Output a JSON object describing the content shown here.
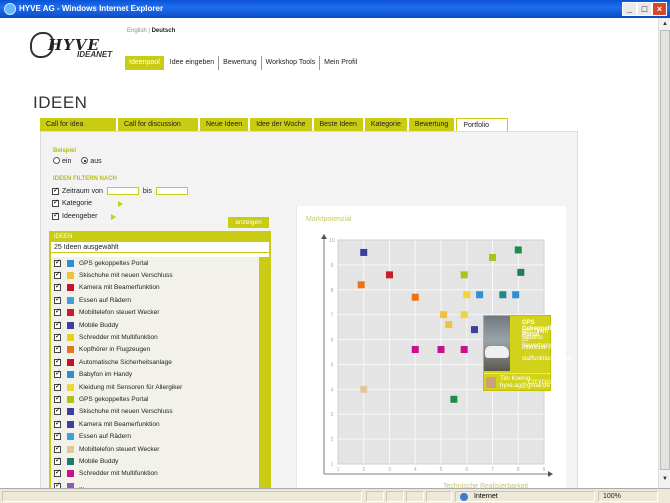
{
  "window": {
    "title": "HYVE AG - Windows Internet Explorer"
  },
  "header": {
    "logo_text": "HYVE",
    "logo_sub": "IDEANET",
    "lang_english": "English",
    "lang_sep": " | ",
    "lang_deutsch": "Deutsch",
    "nav": [
      "Ideenpool",
      "Idee eingeben",
      "Bewertung",
      "Workshop Tools",
      "Mein Profil"
    ]
  },
  "page": {
    "title": "IDEEN",
    "tabs": [
      "Call for idea",
      "Call for discussion",
      "Neue Ideen",
      "Idee der Woche",
      "Beste Ideen",
      "Kategorie",
      "Bewertung",
      "Portfolio"
    ],
    "active_tab": "Portfolio"
  },
  "filters": {
    "beispiel_label": "Beispiel",
    "radio_ein": "ein",
    "radio_aus": "aus",
    "filter_head": "IDEEN FILTERN NACH",
    "zeitraum_label": "Zeitraum",
    "von_label": "von",
    "bis_label": "bis",
    "kategorie_label": "Kategorie",
    "ideengeber_label": "Ideengeber",
    "show_button": "anzeigen"
  },
  "ideas": {
    "header": "IDEEN",
    "count": "25 Ideen ausgewählt",
    "items": [
      {
        "label": "GPS gekoppeltes Portal",
        "color": "#2e8fd3"
      },
      {
        "label": "Skischuhe mit neuen Verschluss",
        "color": "#f0c23a"
      },
      {
        "label": "Kamera mit Beamerfunktion",
        "color": "#c8102e"
      },
      {
        "label": "Essen auf Rädern",
        "color": "#3fa0e0"
      },
      {
        "label": "Mobiltelefon steuert Wecker",
        "color": "#c81e2a"
      },
      {
        "label": "Mobile Buddy",
        "color": "#3b3fa0"
      },
      {
        "label": "Schredder mit Multifunktion",
        "color": "#e6d21a"
      },
      {
        "label": "Kopfhörer in Flugzeugen",
        "color": "#e8731a"
      },
      {
        "label": "Automatische Sicherheitsanlage",
        "color": "#c8102e"
      },
      {
        "label": "Babyfon im Handy",
        "color": "#2e8fd3"
      },
      {
        "label": "Kleidung mit Sensoren für Allergiker",
        "color": "#f0d43a"
      },
      {
        "label": "GPS gekoppeltes Portal",
        "color": "#b0bf1a"
      },
      {
        "label": "Skischuhe mit neuen Verschluss",
        "color": "#3b3fa0"
      },
      {
        "label": "Kamera mit Beamerfunktion",
        "color": "#3b3fa0"
      },
      {
        "label": "Essen auf Rädern",
        "color": "#3fa0e0"
      },
      {
        "label": "Mobiltelefon steuert Wecker",
        "color": "#e0c89a"
      },
      {
        "label": "Mobile Buddy",
        "color": "#1f7a6a"
      },
      {
        "label": "Schredder mit Multifunktion",
        "color": "#c8108a"
      },
      {
        "label": "...",
        "color": "#8a5ac0"
      }
    ]
  },
  "chart_data": {
    "type": "scatter",
    "title": "Marktpotenzial",
    "xlabel": "Technische Realisierbarkeit",
    "ylabel": "",
    "xlim": [
      1,
      9
    ],
    "ylim": [
      1,
      10
    ],
    "x_ticks": [
      "1",
      "2",
      "3",
      "4",
      "5",
      "6",
      "7",
      "8",
      "9"
    ],
    "y_ticks": [
      "1",
      "2",
      "3",
      "4",
      "5",
      "6",
      "7",
      "8",
      "9",
      "10"
    ],
    "points": [
      {
        "x": 2.0,
        "y": 9.5,
        "color": "#3b3fa0"
      },
      {
        "x": 7.0,
        "y": 9.3,
        "color": "#b0bf1a"
      },
      {
        "x": 8.0,
        "y": 9.6,
        "color": "#1f8a4a"
      },
      {
        "x": 1.9,
        "y": 8.2,
        "color": "#e8731a"
      },
      {
        "x": 3.0,
        "y": 8.6,
        "color": "#c81e2a"
      },
      {
        "x": 5.9,
        "y": 8.6,
        "color": "#b0bf1a"
      },
      {
        "x": 8.1,
        "y": 8.7,
        "color": "#1f7a6a"
      },
      {
        "x": 4.0,
        "y": 7.7,
        "color": "#e8731a"
      },
      {
        "x": 6.0,
        "y": 7.8,
        "color": "#f0d43a"
      },
      {
        "x": 6.5,
        "y": 7.8,
        "color": "#2e8fd3"
      },
      {
        "x": 7.4,
        "y": 7.8,
        "color": "#1f8a8a"
      },
      {
        "x": 7.9,
        "y": 7.8,
        "color": "#2e8fd3"
      },
      {
        "x": 5.1,
        "y": 7.0,
        "color": "#f0c23a"
      },
      {
        "x": 5.9,
        "y": 7.0,
        "color": "#f0d43a"
      },
      {
        "x": 5.3,
        "y": 6.6,
        "color": "#f0c23a"
      },
      {
        "x": 6.3,
        "y": 6.4,
        "color": "#3b3fa0"
      },
      {
        "x": 7.3,
        "y": 6.8,
        "color": "#c8102e"
      },
      {
        "x": 7.8,
        "y": 6.6,
        "color": "#e6d21a"
      },
      {
        "x": 4.0,
        "y": 5.6,
        "color": "#c8108a"
      },
      {
        "x": 5.0,
        "y": 5.6,
        "color": "#c8108a"
      },
      {
        "x": 5.9,
        "y": 5.6,
        "color": "#c8108a"
      },
      {
        "x": 8.5,
        "y": 4.9,
        "color": "#8a5ac0"
      },
      {
        "x": 2.0,
        "y": 4.0,
        "color": "#e0c89a"
      },
      {
        "x": 5.5,
        "y": 3.6,
        "color": "#1f8a4a"
      }
    ]
  },
  "popup": {
    "title": "GPS Gekoppeltes Portal",
    "author": "von Timm Roberts",
    "ratings": "22 Bewertungen",
    "interest": "Interesse",
    "tagline": "staffunktionskredre",
    "user_name": "Tim Koenig",
    "user_sub": "hyve.ag@gmail.de",
    "action": "CITYGGNSE"
  },
  "statusbar": {
    "zone": "Internet",
    "zoom": "100%"
  }
}
